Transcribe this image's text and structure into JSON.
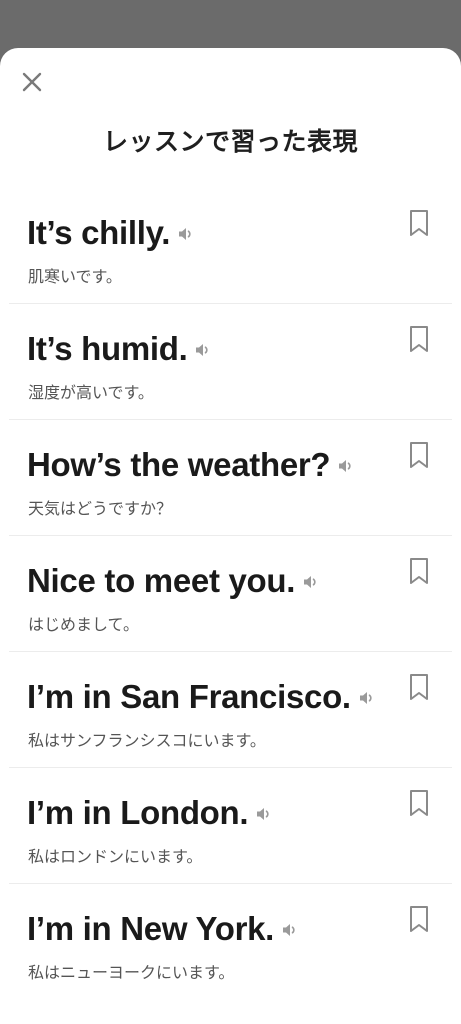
{
  "header": {
    "title": "レッスンで習った表現",
    "close_icon": "close-icon"
  },
  "phrases": [
    {
      "english": "It’s chilly.",
      "japanese": "肌寒いです。"
    },
    {
      "english": "It’s humid.",
      "japanese": "湿度が高いです。"
    },
    {
      "english": "How’s the weather?",
      "japanese": "天気はどうですか？"
    },
    {
      "english": "Nice to meet you.",
      "japanese": "はじめまして。"
    },
    {
      "english": "I’m in San Francisco.",
      "japanese": "私はサンフランシスコにいます。"
    },
    {
      "english": "I’m in London.",
      "japanese": "私はロンドンにいます。"
    },
    {
      "english": "I’m in New York.",
      "japanese": "私はニューヨークにいます。"
    }
  ],
  "icons": {
    "speaker": "speaker-icon",
    "bookmark": "bookmark-icon"
  },
  "colors": {
    "overlay": "#6b6b6b",
    "sheet": "#ffffff",
    "text_primary": "#1a1a1a",
    "text_secondary": "#555555",
    "icon_gray": "#8a8a8a"
  }
}
